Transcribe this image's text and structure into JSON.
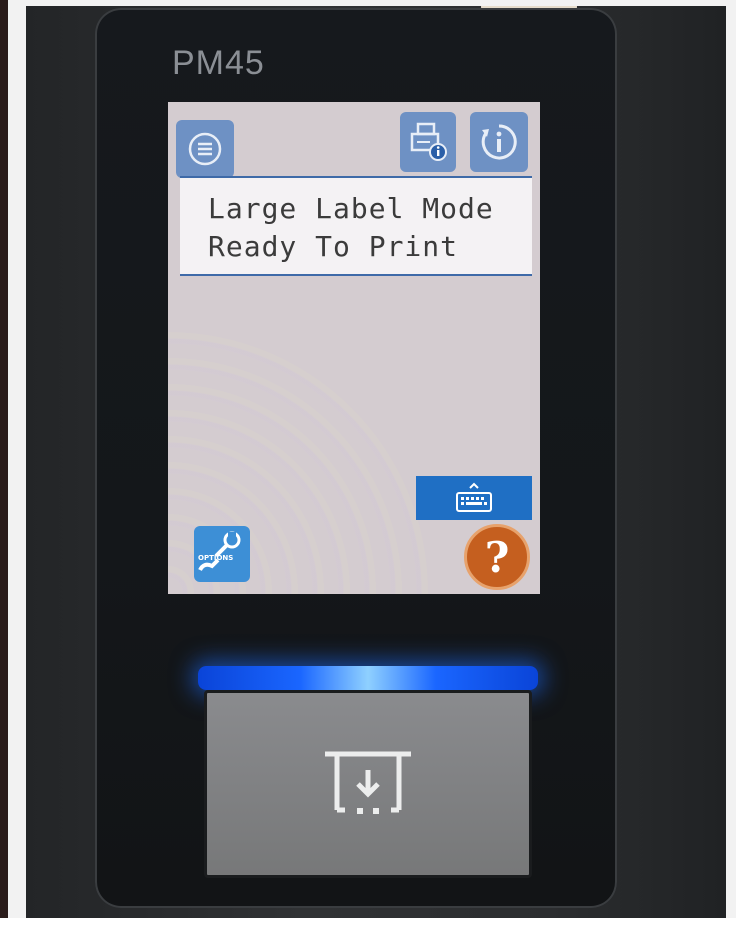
{
  "device": {
    "model": "PM45"
  },
  "screen": {
    "message_line_1": "Large Label Mode",
    "message_line_2": "Ready To Print",
    "options_label": "OPTIONS",
    "help_label": "?"
  },
  "icons": {
    "menu": "menu-icon",
    "printer_info": "printer-info-icon",
    "info": "info-icon",
    "keyboard": "keyboard-icon",
    "options": "wrench-icon",
    "help": "help-icon",
    "feed": "feed-icon"
  },
  "colors": {
    "button_blue": "#6e91c4",
    "keyboard_blue": "#1f6fc4",
    "options_blue": "#3d8fd6",
    "help_orange": "#c55f1f",
    "led_blue": "#1a66ff",
    "screen_border_blue": "#3e6aa8"
  }
}
